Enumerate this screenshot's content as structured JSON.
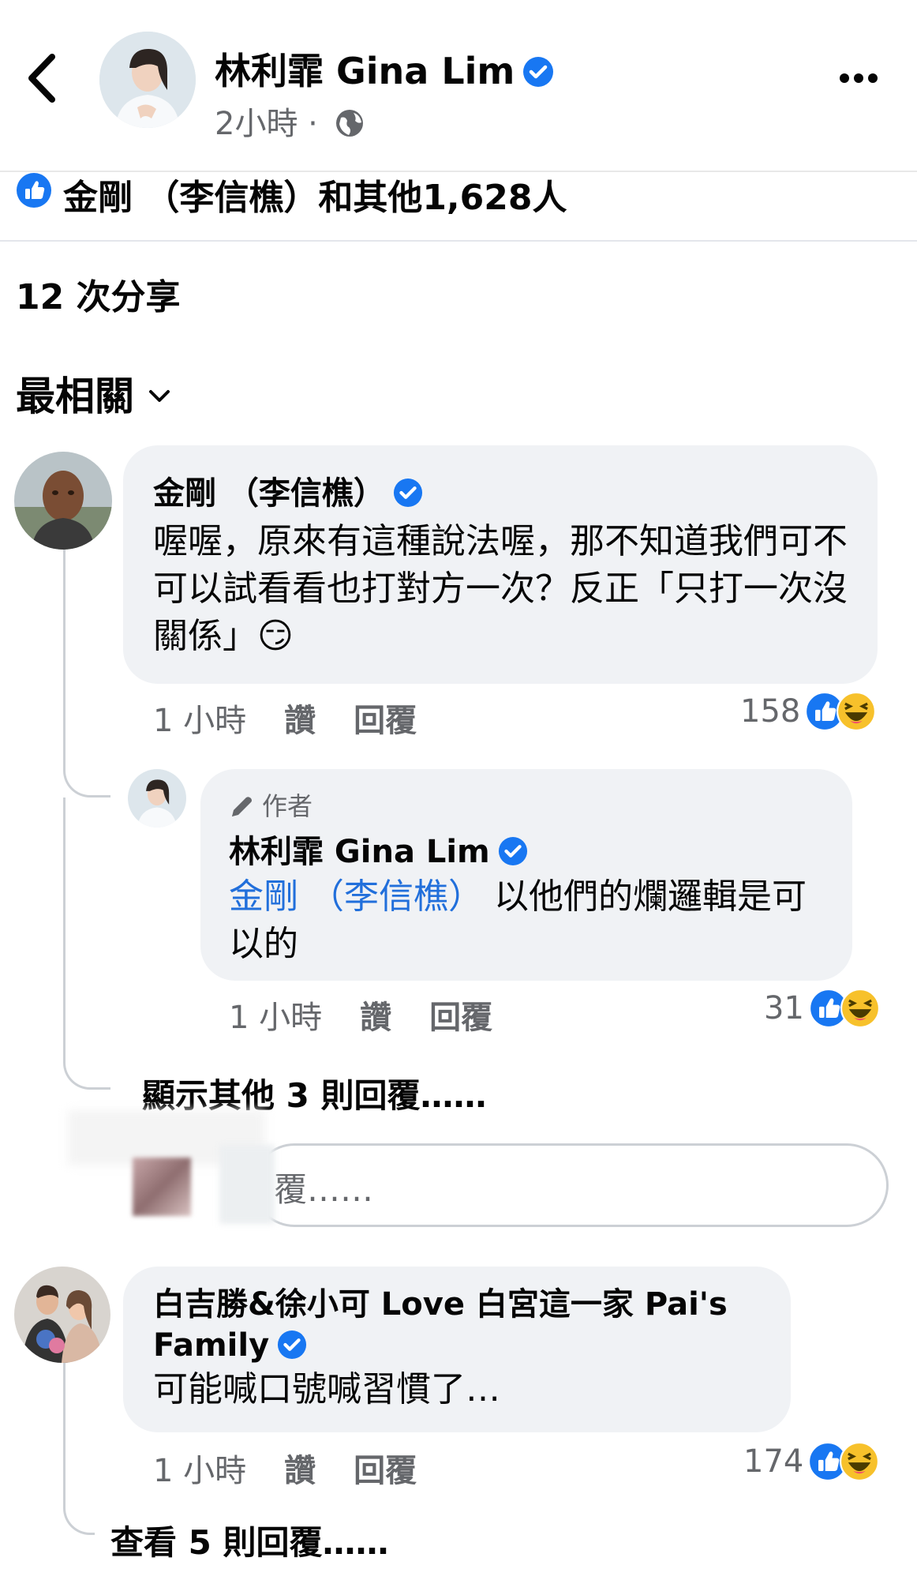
{
  "header": {
    "name": "林利霏 Gina Lim",
    "time": "2小時",
    "separator": "·"
  },
  "post": {
    "likes_text": "金剛 （李信樵）和其他1,628人",
    "shares_text": "12 次分享",
    "sort_label": "最相關"
  },
  "comments": [
    {
      "name": "金剛 （李信樵）",
      "text": "喔喔，原來有這種說法喔，那不知道我們可不可以試看看也打對方一次？反正「只打一次沒關係」😏",
      "time": "1 小時",
      "like_label": "讚",
      "reply_label": "回覆",
      "reaction_count": "158",
      "replies": [
        {
          "author_tag": "作者",
          "name": "林利霏 Gina Lim",
          "mention": "金剛 （李信樵）",
          "text": " 以他們的爛邏輯是可以的",
          "time": "1 小時",
          "like_label": "讚",
          "reply_label": "回覆",
          "reaction_count": "31"
        }
      ],
      "more_replies": "顯示其他 3 則回覆……",
      "reply_placeholder": "覆……"
    },
    {
      "name": "白吉勝&徐小可 Love 白宮這一家 Pai's Family",
      "text": "可能喊口號喊習慣了…",
      "time": "1 小時",
      "like_label": "讚",
      "reply_label": "回覆",
      "reaction_count": "174",
      "more_replies": "查看 5 則回覆……"
    }
  ],
  "colors": {
    "verified_blue": "#1877f2",
    "like_blue": "#1877f2",
    "haha_yellow": "#f7c12b",
    "mention_blue": "#216fdb",
    "bubble_bg": "#f0f2f5"
  }
}
